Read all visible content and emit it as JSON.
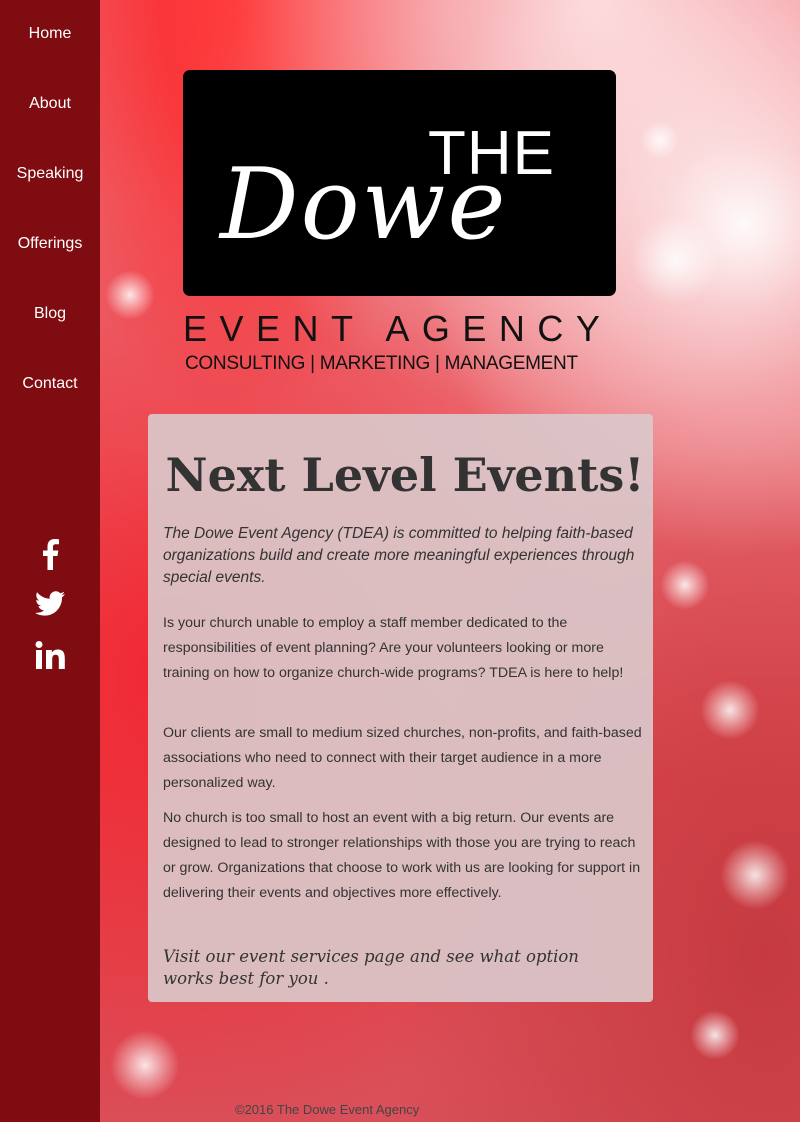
{
  "nav": {
    "items": [
      {
        "label": "Home"
      },
      {
        "label": "About"
      },
      {
        "label": "Speaking"
      },
      {
        "label": "Offerings"
      },
      {
        "label": "Blog"
      },
      {
        "label": "Contact"
      }
    ]
  },
  "social": {
    "icons": [
      "facebook-icon",
      "twitter-icon",
      "linkedin-icon"
    ]
  },
  "logo": {
    "script": "Dowe",
    "the": "THE",
    "agency": "EVENT AGENCY",
    "tagline": "CONSULTING | MARKETING | MANAGEMENT"
  },
  "main": {
    "title": "Next Level Events!",
    "intro": "The Dowe Event Agency (TDEA) is committed to helping faith-based organizations build and create more meaningful experiences through special events.",
    "paragraphs": [
      "Is your church unable to employ a staff member dedicated to the responsibilities of event planning? Are your volunteers looking or more training on how to organize church-wide programs? TDEA is here to help!",
      "Our clients are small to medium sized churches, non-profits, and faith-based associations who need to connect with their target audience in a more personalized way.",
      "No church is too small to host an event with a big return. Our events are designed to lead to stronger relationships with those you are trying to reach or grow. Organizations that choose to work with us are looking for support in delivering their events and objectives more effectively."
    ],
    "cta": "Visit our event services page and see what option works best for you ."
  },
  "footer": {
    "copyright": "©2016 The Dowe Event Agency"
  },
  "colors": {
    "sidebar": "#7f0c10",
    "panel": "#dac8ca",
    "text": "#333333"
  }
}
